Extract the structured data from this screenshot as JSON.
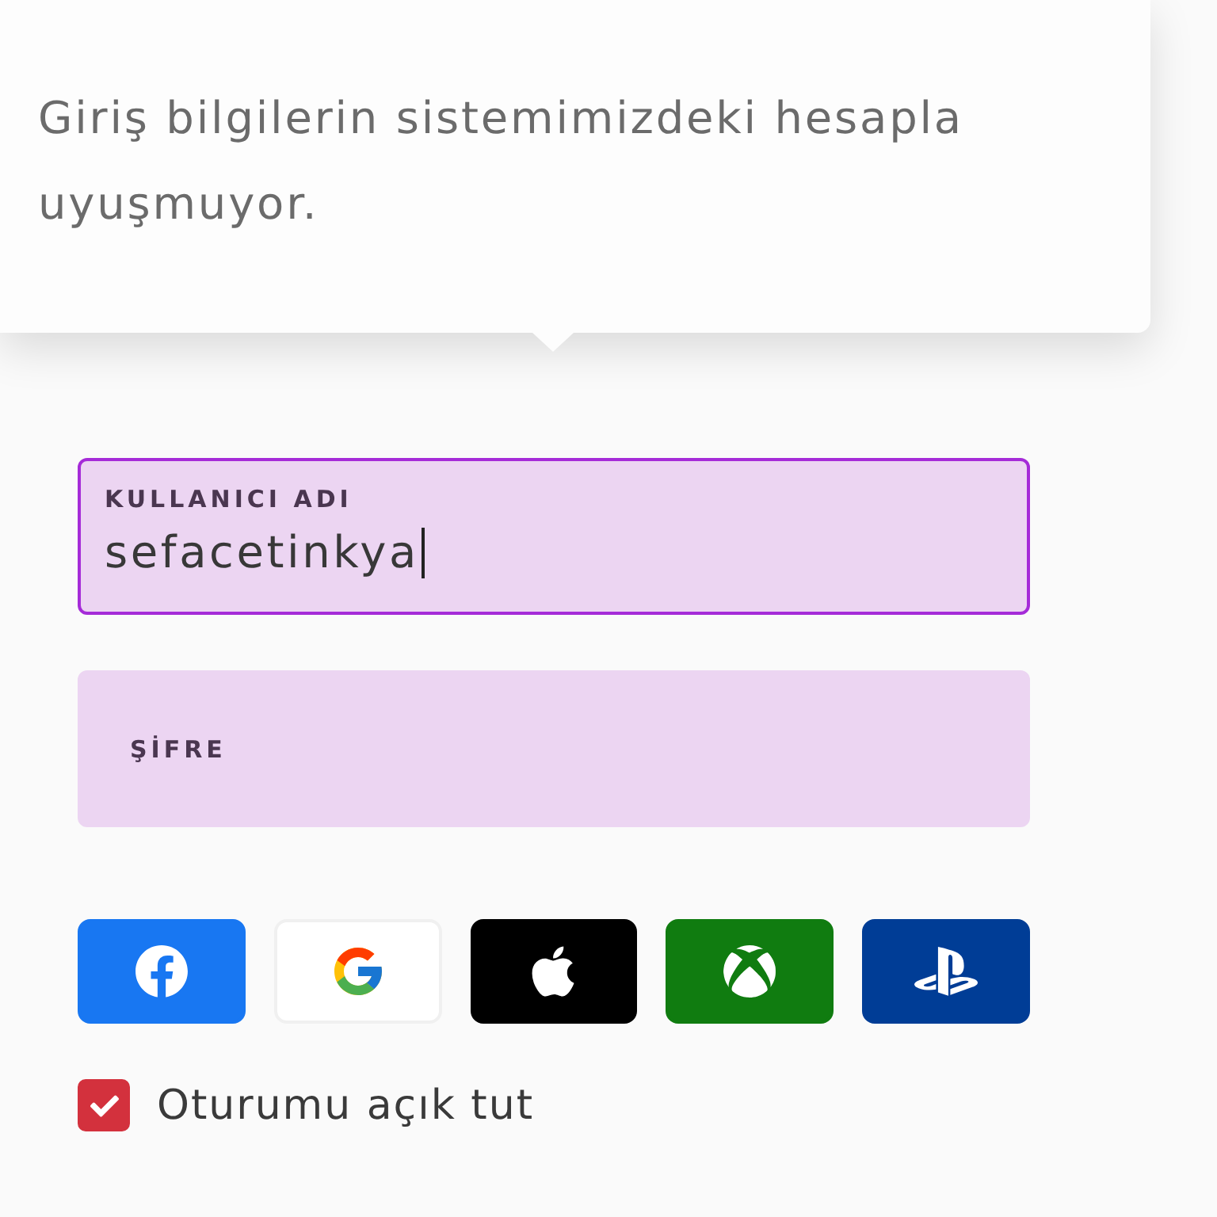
{
  "tooltip": {
    "message": "Giriş bilgilerin sistemimizdeki hesapla uyuşmuyor."
  },
  "fields": [
    {
      "label": "KULLANICI ADI",
      "value": "sefacetinkya",
      "focused": true
    },
    {
      "label": "ŞİFRE",
      "focused": false
    }
  ],
  "social_buttons": [
    {
      "kind": "facebook"
    },
    {
      "kind": "google"
    },
    {
      "kind": "apple"
    },
    {
      "kind": "xbox"
    },
    {
      "kind": "playstation"
    }
  ],
  "remember": {
    "label": "Oturumu açık tut",
    "checked": true
  }
}
